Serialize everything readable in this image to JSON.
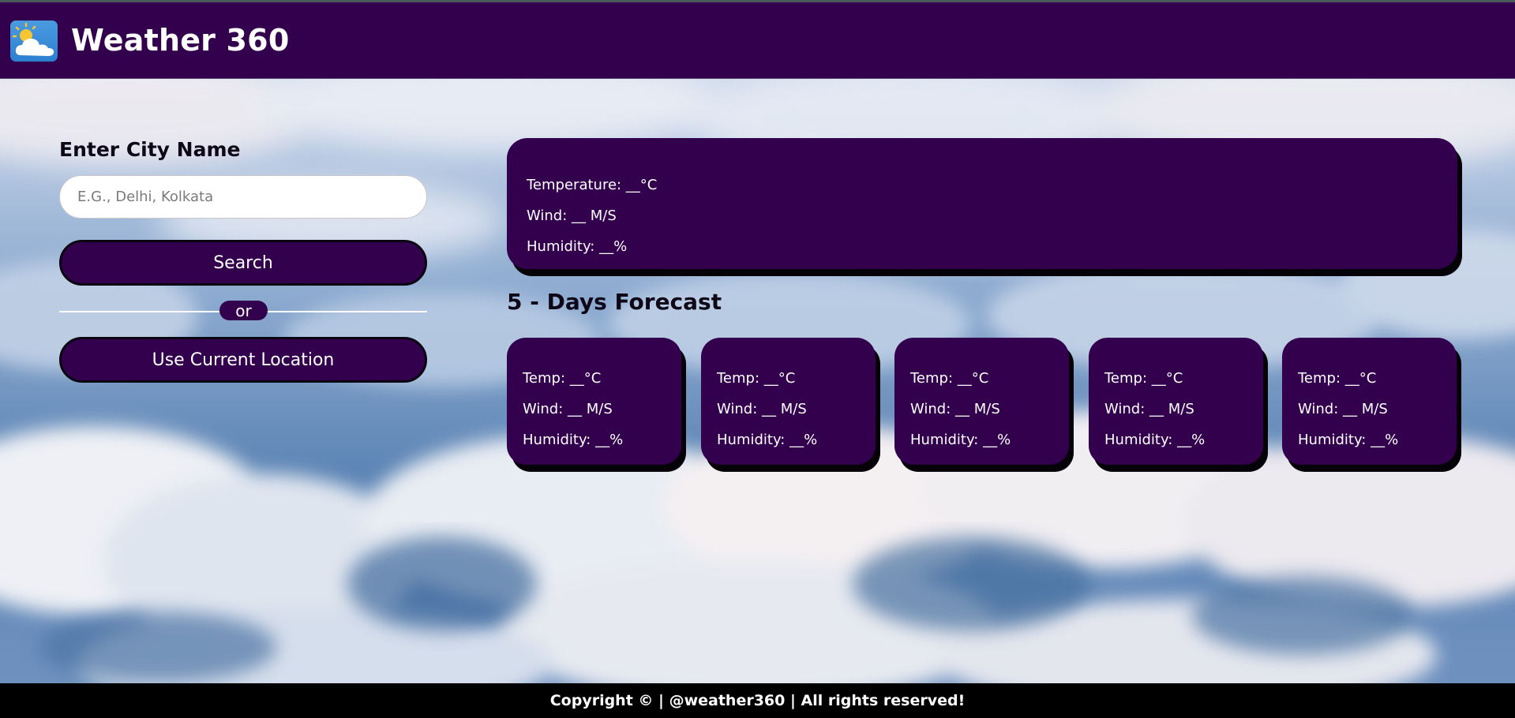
{
  "header": {
    "title": "Weather 360",
    "logo_icon": "weather-cloud-sun-icon"
  },
  "search": {
    "label": "Enter City Name",
    "placeholder": "E.G., Delhi, Kolkata",
    "value": "",
    "search_button": "Search",
    "divider_text": "or",
    "location_button": "Use Current Location"
  },
  "current": {
    "temperature": "Temperature: __°C",
    "wind": "Wind: __ M/S",
    "humidity": "Humidity: __%"
  },
  "forecast": {
    "title": "5 - Days Forecast",
    "days": [
      {
        "temp": "Temp: __°C",
        "wind": "Wind: __ M/S",
        "humidity": "Humidity: __%"
      },
      {
        "temp": "Temp: __°C",
        "wind": "Wind: __ M/S",
        "humidity": "Humidity: __%"
      },
      {
        "temp": "Temp: __°C",
        "wind": "Wind: __ M/S",
        "humidity": "Humidity: __%"
      },
      {
        "temp": "Temp: __°C",
        "wind": "Wind: __ M/S",
        "humidity": "Humidity: __%"
      },
      {
        "temp": "Temp: __°C",
        "wind": "Wind: __ M/S",
        "humidity": "Humidity: __%"
      }
    ]
  },
  "footer": {
    "text": "Copyright © | @weather360 | All rights reserved!"
  },
  "colors": {
    "header_bg": "#33004d",
    "card_bg": "#33004d",
    "footer_bg": "#000000",
    "text_light": "#ffffff"
  }
}
